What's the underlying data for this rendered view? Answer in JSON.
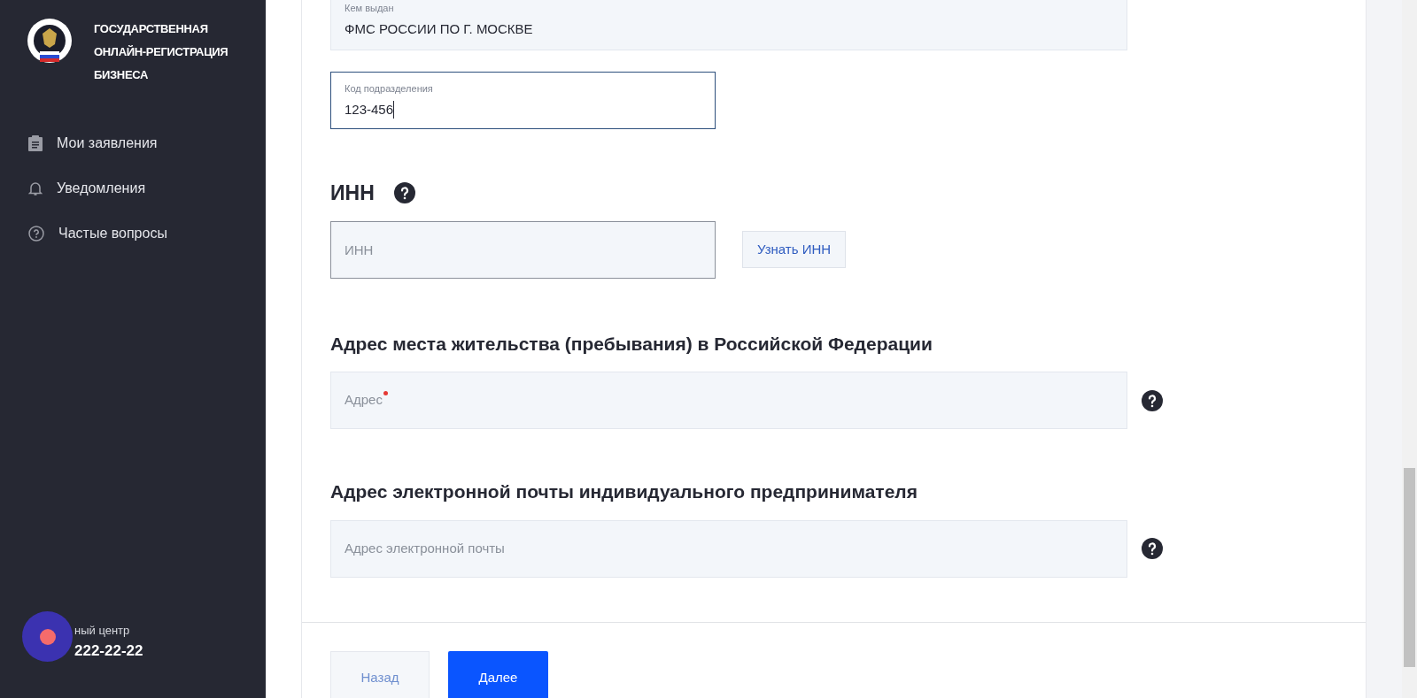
{
  "sidebar": {
    "title_lines": [
      "ГОСУДАРСТВЕННАЯ",
      "ОНЛАЙН-РЕГИСТРАЦИЯ",
      "БИЗНЕСА"
    ],
    "items": [
      {
        "label": "Мои заявления"
      },
      {
        "label": "Уведомления"
      },
      {
        "label": "Частые вопросы"
      }
    ],
    "contact": {
      "label": "ный центр",
      "phone": "222-22-22"
    }
  },
  "form": {
    "issued_by": {
      "label": "Кем выдан",
      "value": "ФМС РОССИИ ПО Г. МОСКВЕ"
    },
    "department_code": {
      "label": "Код подразделения",
      "value": "123-456",
      "focused": true
    },
    "inn": {
      "heading": "ИНН",
      "placeholder": "ИНН",
      "button": "Узнать ИНН"
    },
    "address": {
      "heading": "Адрес места жительства (пребывания) в Российской Федерации",
      "placeholder": "Адрес",
      "required": true
    },
    "email": {
      "heading": "Адрес электронной почты индивидуального предпринимателя",
      "placeholder": "Адрес электронной почты"
    }
  },
  "buttons": {
    "back": "Назад",
    "next": "Далее"
  }
}
